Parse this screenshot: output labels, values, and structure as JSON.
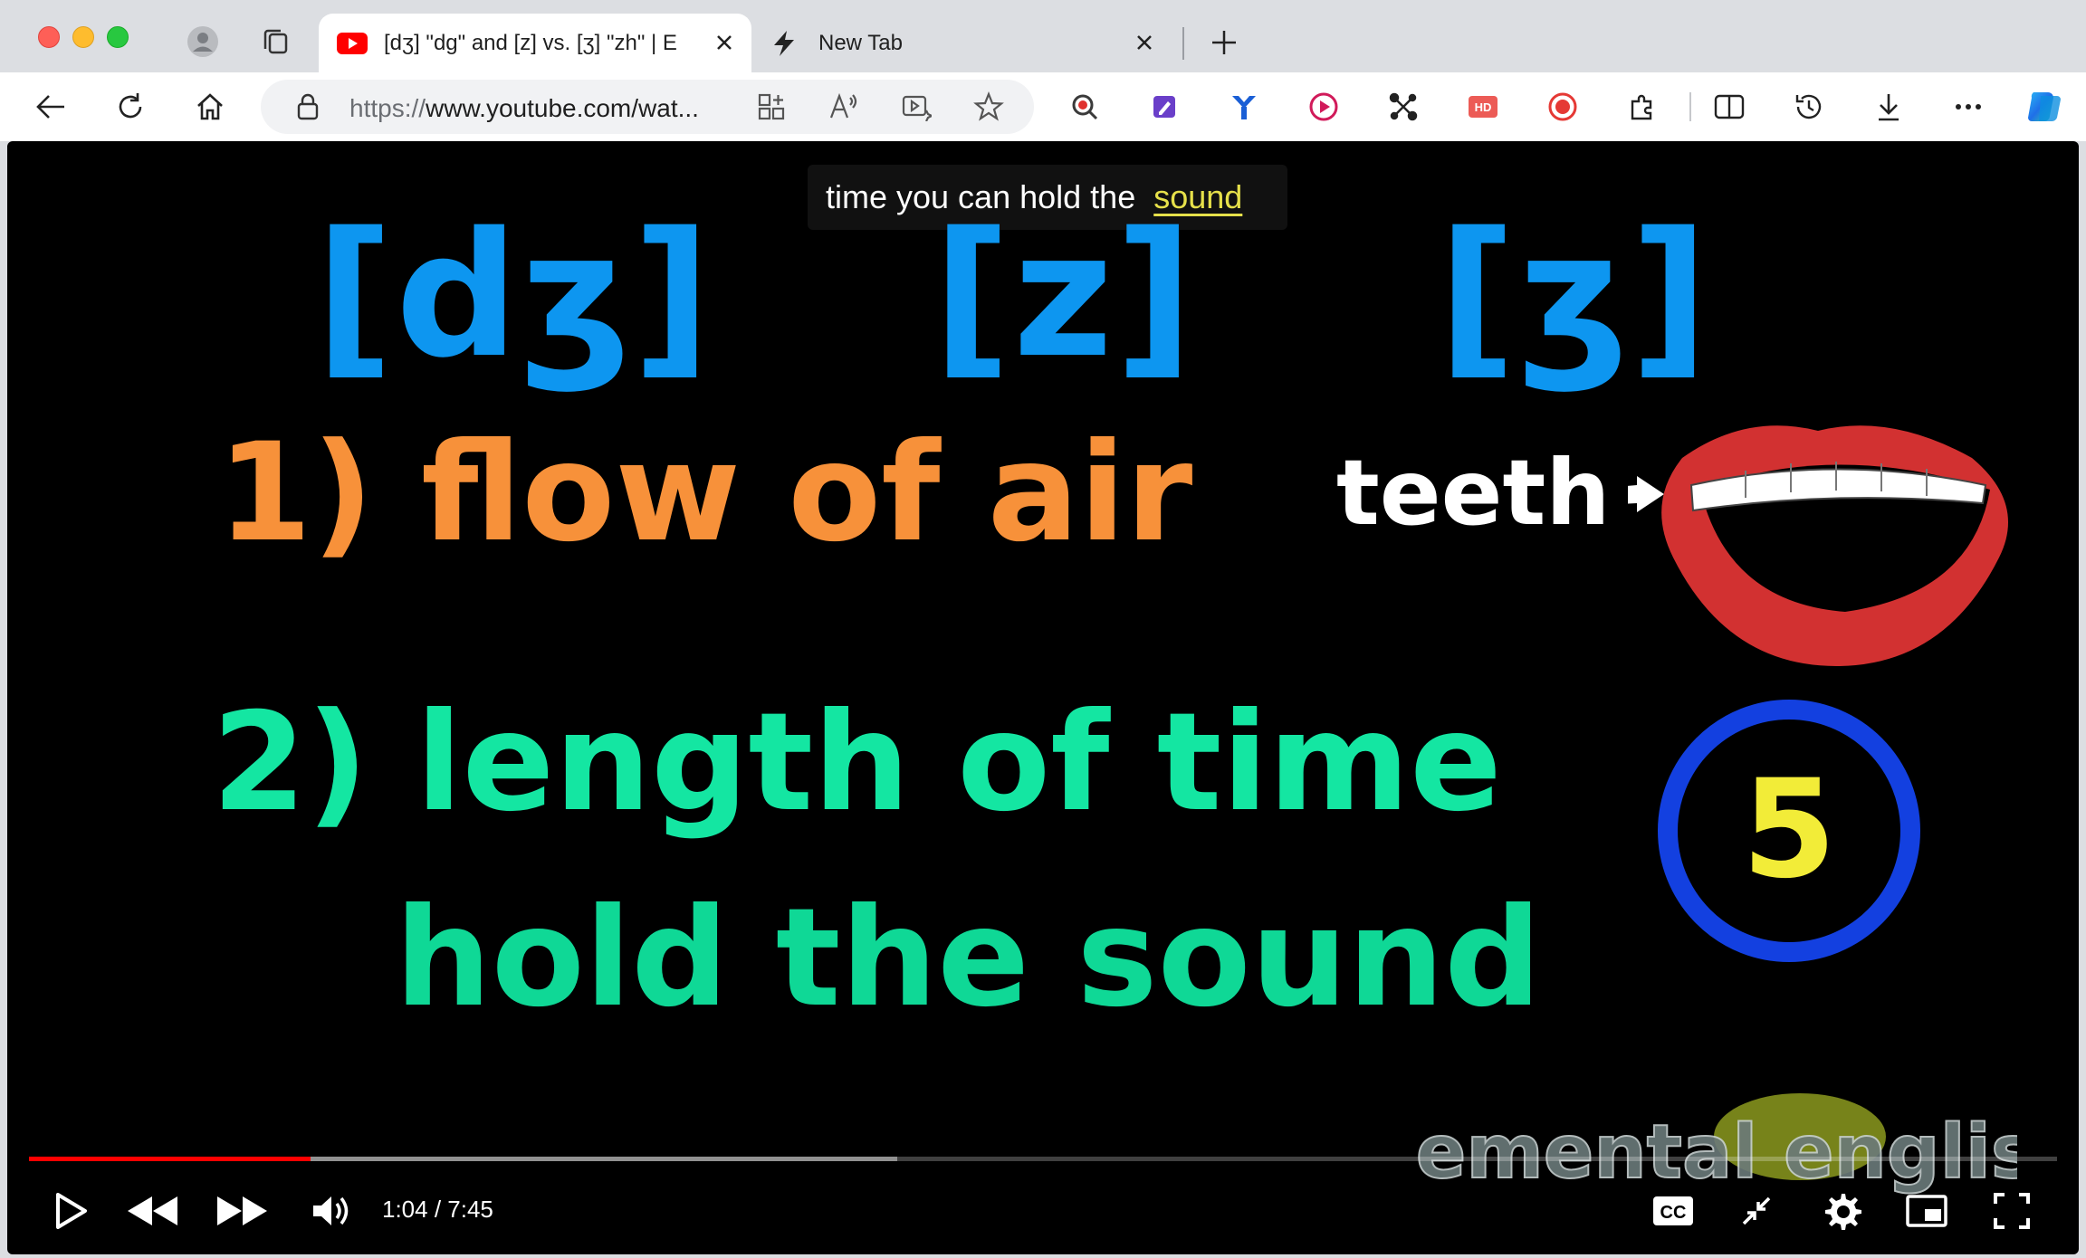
{
  "tabs": [
    {
      "title": "[dʒ] \"dg\" and [z] vs. [ʒ] \"zh\" | E",
      "icon": "youtube-icon",
      "active": true
    },
    {
      "title": "New Tab",
      "icon": "lightning-icon",
      "active": false
    }
  ],
  "address_bar": {
    "scheme": "https://",
    "host_path": "www.youtube.com/wat..."
  },
  "video": {
    "caption": {
      "text": "time you can hold the",
      "highlight": "sound"
    },
    "ipa_symbols": [
      "[dʒ]",
      "[z]",
      "[ʒ]"
    ],
    "point1": "1) flow of air",
    "point2_line1": "2) length of time",
    "point2_line2": "hold the sound",
    "teeth_label": "teeth",
    "timer_number": "5",
    "watermark": "elemental english",
    "progress_fraction": 0.139,
    "buffered_fraction": 0.428
  },
  "player": {
    "time": "1:04 / 7:45",
    "cc_label": "CC"
  },
  "colors": {
    "accent_red": "#ff0000",
    "ipa_blue": "#0d96f0",
    "orange": "#f7913a",
    "green": "#14e6a2",
    "timer_ring": "#1340e0",
    "timer_number": "#f2ec38"
  }
}
